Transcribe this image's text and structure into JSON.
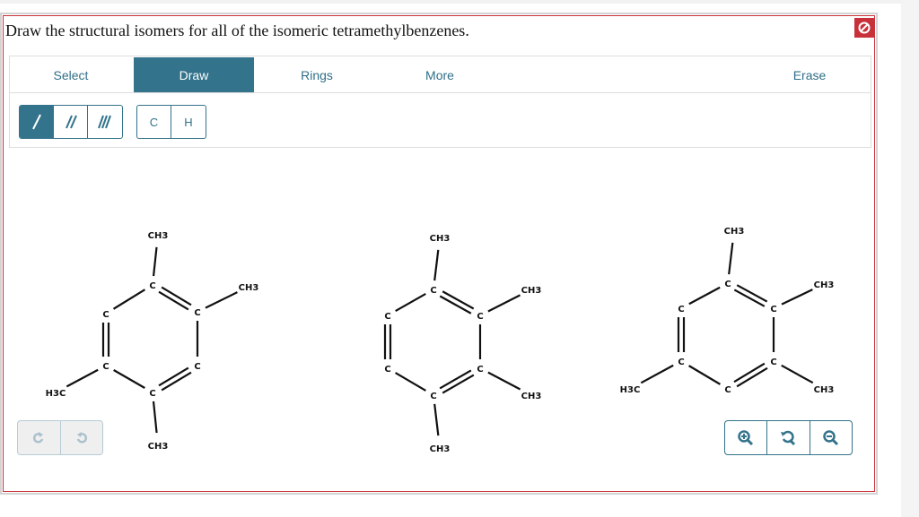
{
  "question": "Draw the structural isomers for all of the isomeric tetramethylbenzenes.",
  "tabs": [
    {
      "label": "Select",
      "active": false
    },
    {
      "label": "Draw",
      "active": true
    },
    {
      "label": "Rings",
      "active": false
    },
    {
      "label": "More",
      "active": false
    },
    {
      "label": "Erase",
      "active": false
    }
  ],
  "bond_tools": [
    {
      "icon": "single-bond-icon",
      "selected": true
    },
    {
      "icon": "double-bond-icon",
      "selected": false
    },
    {
      "icon": "triple-bond-icon",
      "selected": false
    }
  ],
  "atom_tools": [
    "C",
    "H"
  ],
  "history_buttons": [
    "redo-icon",
    "undo-icon"
  ],
  "zoom_buttons": [
    "zoom-in-icon",
    "reset-zoom-icon",
    "zoom-out-icon"
  ],
  "colors": {
    "accent": "#33738b",
    "error": "#c8303a"
  },
  "molecules": [
    {
      "atoms": [
        "C",
        "C",
        "C",
        "C",
        "C",
        "C",
        "CH3",
        "CH3",
        "H3C",
        "CH3"
      ],
      "bonds": [
        [
          0,
          1,
          2
        ],
        [
          1,
          2,
          1
        ],
        [
          2,
          3,
          2
        ],
        [
          3,
          4,
          1
        ],
        [
          4,
          5,
          2
        ],
        [
          5,
          0,
          1
        ],
        [
          0,
          6,
          1
        ],
        [
          1,
          7,
          1
        ],
        [
          4,
          8,
          1
        ],
        [
          3,
          9,
          1
        ]
      ]
    },
    {
      "atoms": [
        "C",
        "C",
        "C",
        "C",
        "C",
        "C",
        "CH3",
        "CH3",
        "CH3",
        "CH3"
      ],
      "bonds": [
        [
          0,
          1,
          2
        ],
        [
          1,
          2,
          1
        ],
        [
          2,
          3,
          2
        ],
        [
          3,
          4,
          1
        ],
        [
          4,
          5,
          2
        ],
        [
          5,
          0,
          1
        ],
        [
          0,
          6,
          1
        ],
        [
          1,
          7,
          1
        ],
        [
          2,
          8,
          1
        ],
        [
          3,
          9,
          1
        ]
      ]
    },
    {
      "atoms": [
        "C",
        "C",
        "C",
        "C",
        "C",
        "C",
        "CH3",
        "CH3",
        "CH3",
        "H3C"
      ],
      "bonds": [
        [
          0,
          1,
          2
        ],
        [
          1,
          2,
          1
        ],
        [
          2,
          3,
          2
        ],
        [
          3,
          4,
          1
        ],
        [
          4,
          5,
          2
        ],
        [
          5,
          0,
          1
        ],
        [
          0,
          6,
          1
        ],
        [
          1,
          7,
          1
        ],
        [
          2,
          8,
          1
        ],
        [
          4,
          9,
          1
        ]
      ]
    }
  ]
}
